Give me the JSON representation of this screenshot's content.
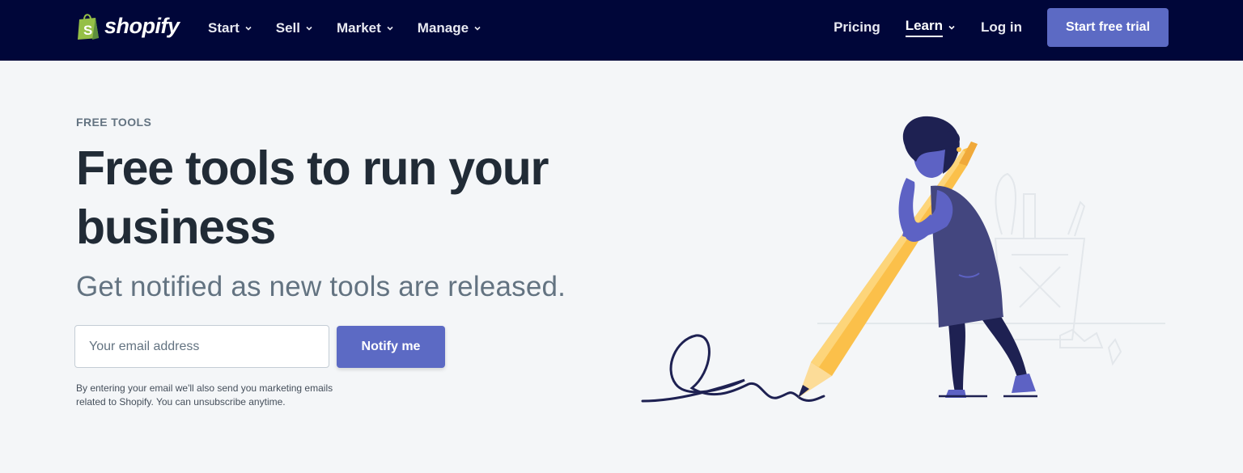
{
  "header": {
    "logo_text": "shopify",
    "nav_left": [
      {
        "label": "Start",
        "icon": "chevron-down-icon"
      },
      {
        "label": "Sell",
        "icon": "chevron-down-icon"
      },
      {
        "label": "Market",
        "icon": "chevron-down-icon"
      },
      {
        "label": "Manage",
        "icon": "chevron-down-icon"
      }
    ],
    "pricing_label": "Pricing",
    "learn_label": "Learn",
    "login_label": "Log in",
    "cta_label": "Start free trial"
  },
  "hero": {
    "eyebrow": "FREE TOOLS",
    "headline": "Free tools to run your business",
    "subhead": "Get notified as new tools are released.",
    "email_placeholder": "Your email address",
    "email_value": "",
    "notify_label": "Notify me",
    "disclaimer": "By entering your email we'll also send you marketing emails related to Shopify. You can unsubscribe anytime."
  },
  "colors": {
    "header_bg": "#000639",
    "accent": "#5c6ac4",
    "page_bg": "#f4f6f8",
    "logo_bag": "#95bf47",
    "pencil": "#fbc04a",
    "figure_dress": "#43467f",
    "figure_skin": "#5d62c4"
  }
}
